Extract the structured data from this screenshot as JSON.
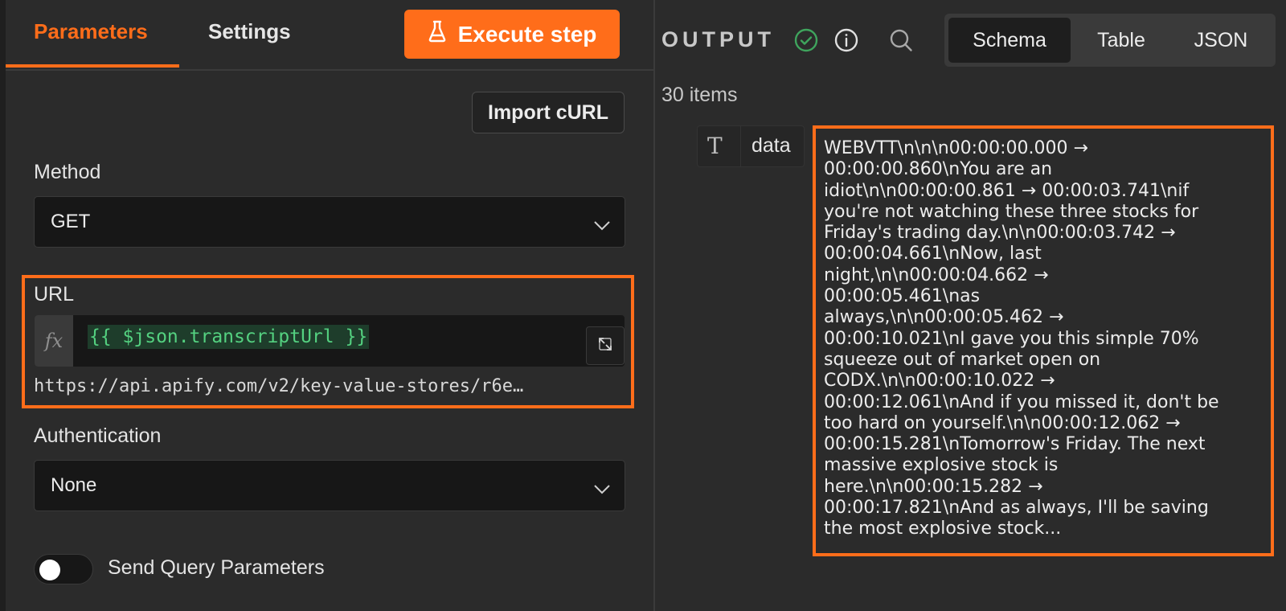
{
  "left_panel": {
    "tabs": [
      {
        "label": "Parameters",
        "active": true
      },
      {
        "label": "Settings",
        "active": false
      }
    ],
    "execute_button": {
      "label": "Execute step",
      "icon": "flask-icon"
    },
    "import_curl_button": {
      "label": "Import cURL"
    },
    "method": {
      "label": "Method",
      "value": "GET"
    },
    "url": {
      "label": "URL",
      "expression": "{{ $json.transcriptUrl }}",
      "fx_label": "fx",
      "resolved_preview": "https://api.apify.com/v2/key-value-stores/r6e…"
    },
    "authentication": {
      "label": "Authentication",
      "value": "None"
    },
    "send_query_params": {
      "label": "Send Query Parameters",
      "enabled": false
    }
  },
  "output_panel": {
    "title": "OUTPUT",
    "status": "success",
    "view_tabs": [
      {
        "label": "Schema",
        "active": true
      },
      {
        "label": "Table",
        "active": false
      },
      {
        "label": "JSON",
        "active": false
      }
    ],
    "items_count": "30 items",
    "field": {
      "type_icon": "T",
      "key": "data",
      "value": "WEBVTT\\n\\n\\n00:00:00.000 →\n00:00:00.860\\nYou are an\nidiot\\n\\n00:00:00.861 → 00:00:03.741\\nif\nyou're not watching these three stocks for\nFriday's trading day.\\n\\n00:00:03.742 →\n00:00:04.661\\nNow, last\nnight,\\n\\n00:00:04.662 →\n00:00:05.461\\nas\nalways,\\n\\n00:00:05.462 →\n00:00:10.021\\nI gave you this simple 70%\nsqueeze out of market open on\nCODX.\\n\\n00:00:10.022 →\n00:00:12.061\\nAnd if you missed it, don't be\ntoo hard on yourself.\\n\\n00:00:12.062 →\n00:00:15.281\\nTomorrow's Friday. The next\nmassive explosive stock is\nhere.\\n\\n00:00:15.282 →\n00:00:17.821\\nAnd as always, I'll be saving\nthe most explosive stock..."
    }
  },
  "colors": {
    "accent": "#ff6d1a",
    "success": "#3fa45d",
    "expression_text": "#54d180"
  }
}
